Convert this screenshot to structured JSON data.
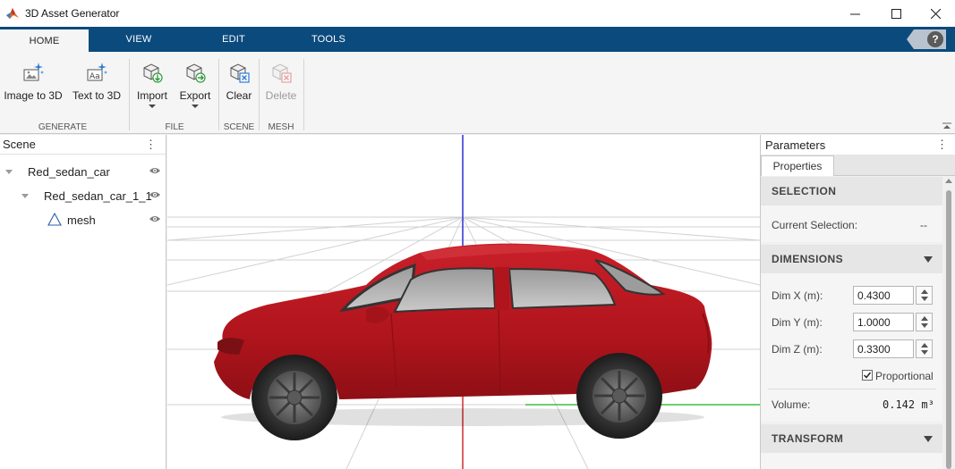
{
  "window": {
    "title": "3D Asset Generator"
  },
  "tabs": [
    {
      "label": "HOME",
      "active": true
    },
    {
      "label": "VIEW",
      "active": false
    },
    {
      "label": "EDIT",
      "active": false
    },
    {
      "label": "TOOLS",
      "active": false
    }
  ],
  "help": {
    "label": "?"
  },
  "toolstrip": {
    "generate": {
      "label": "GENERATE",
      "image_to_3d": "Image to 3D",
      "text_to_3d": "Text to 3D"
    },
    "file": {
      "label": "FILE",
      "import": "Import",
      "export": "Export"
    },
    "scene": {
      "label": "SCENE",
      "clear": "Clear"
    },
    "mesh": {
      "label": "MESH",
      "delete": "Delete"
    }
  },
  "scene_panel": {
    "title": "Scene",
    "items": [
      {
        "label": "Red_sedan_car",
        "level": 0
      },
      {
        "label": "Red_sedan_car_1_1",
        "level": 1
      },
      {
        "label": "mesh",
        "level": 2
      }
    ]
  },
  "params": {
    "title": "Parameters",
    "tab": "Properties",
    "selection": {
      "header": "SELECTION",
      "current_label": "Current Selection:",
      "current_value": "--"
    },
    "dimensions": {
      "header": "DIMENSIONS",
      "dim_x_label": "Dim X (m):",
      "dim_x": "0.4300",
      "dim_y_label": "Dim Y (m):",
      "dim_y": "1.0000",
      "dim_z_label": "Dim Z (m):",
      "dim_z": "0.3300",
      "proportional_label": "Proportional",
      "proportional": true,
      "volume_label": "Volume:",
      "volume_value": "0.142 m³"
    },
    "transform": {
      "header": "TRANSFORM"
    }
  },
  "colors": {
    "tab_bar": "#0b4a7d",
    "car_body": "#b8121b",
    "axis_z": "#3b3bd6",
    "axis_x": "#d23b3b",
    "axis_y": "#3bbf3b"
  }
}
